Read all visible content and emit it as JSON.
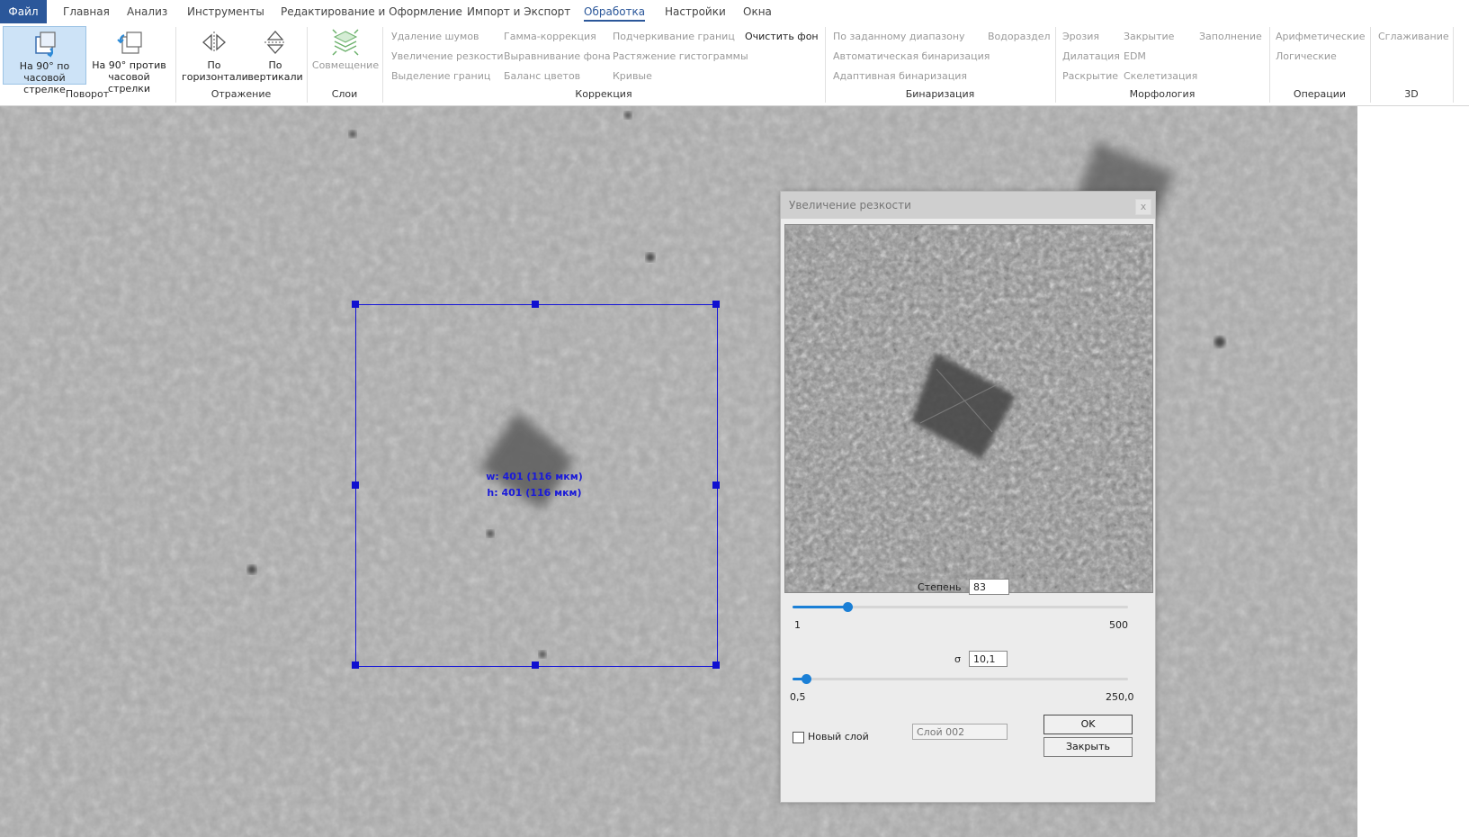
{
  "menu": {
    "file": "Файл",
    "tabs": [
      "Главная",
      "Анализ",
      "Инструменты",
      "Редактирование и Оформление",
      "Импорт и Экспорт",
      "Обработка",
      "Настройки",
      "Окна"
    ],
    "active": "Обработка"
  },
  "ribbon": {
    "rotation": {
      "label": "Поворот",
      "cw": "На 90° по часовой стрелке",
      "ccw": "На 90° против часовой стрелки"
    },
    "reflection": {
      "label": "Отражение",
      "horizontal": "По горизонтали",
      "vertical": "По вертикали"
    },
    "layers": {
      "label": "Слои",
      "combine": "Совмещение"
    },
    "correction": {
      "label": "Коррекция",
      "items": [
        "Удаление шумов",
        "Увеличение резкости",
        "Выделение границ",
        "Гамма-коррекция",
        "Выравнивание фона",
        "Баланс цветов",
        "Подчеркивание границ",
        "Растяжение гистограммы",
        "Кривые",
        "Очистить фон"
      ]
    },
    "binarization": {
      "label": "Бинаризация",
      "items": [
        "По заданному диапазону",
        "Автоматическая бинаризация",
        "Адаптивная бинаризация",
        "Водораздел"
      ]
    },
    "morphology": {
      "label": "Морфология",
      "items": [
        "Эрозия",
        "Дилатация",
        "Раскрытие",
        "Закрытие",
        "EDM",
        "Скелетизация",
        "Заполнение"
      ]
    },
    "operations": {
      "label": "Операции",
      "items": [
        "Арифметические",
        "Логические"
      ]
    },
    "threed": {
      "label": "3D",
      "items": [
        "Сглаживание"
      ]
    }
  },
  "selection": {
    "width_text": "w: 401 (116 мкм)",
    "height_text": "h: 401 (116 мкм)",
    "color": "#1515d8"
  },
  "dialog": {
    "title": "Увеличение резкости",
    "close": "x",
    "degree": {
      "label": "Степень",
      "value": "83",
      "min": "1",
      "max": "500",
      "position": 0.164
    },
    "sigma": {
      "label": "σ",
      "value": "10,1",
      "min": "0,5",
      "max": "250,0",
      "position": 0.039
    },
    "new_layer": {
      "label": "Новый слой",
      "checked": false,
      "name_placeholder": "Слой 002"
    },
    "ok": "OK",
    "close_button": "Закрыть"
  },
  "colors": {
    "accent": "#2b579a",
    "slider": "#1a7fd6"
  }
}
